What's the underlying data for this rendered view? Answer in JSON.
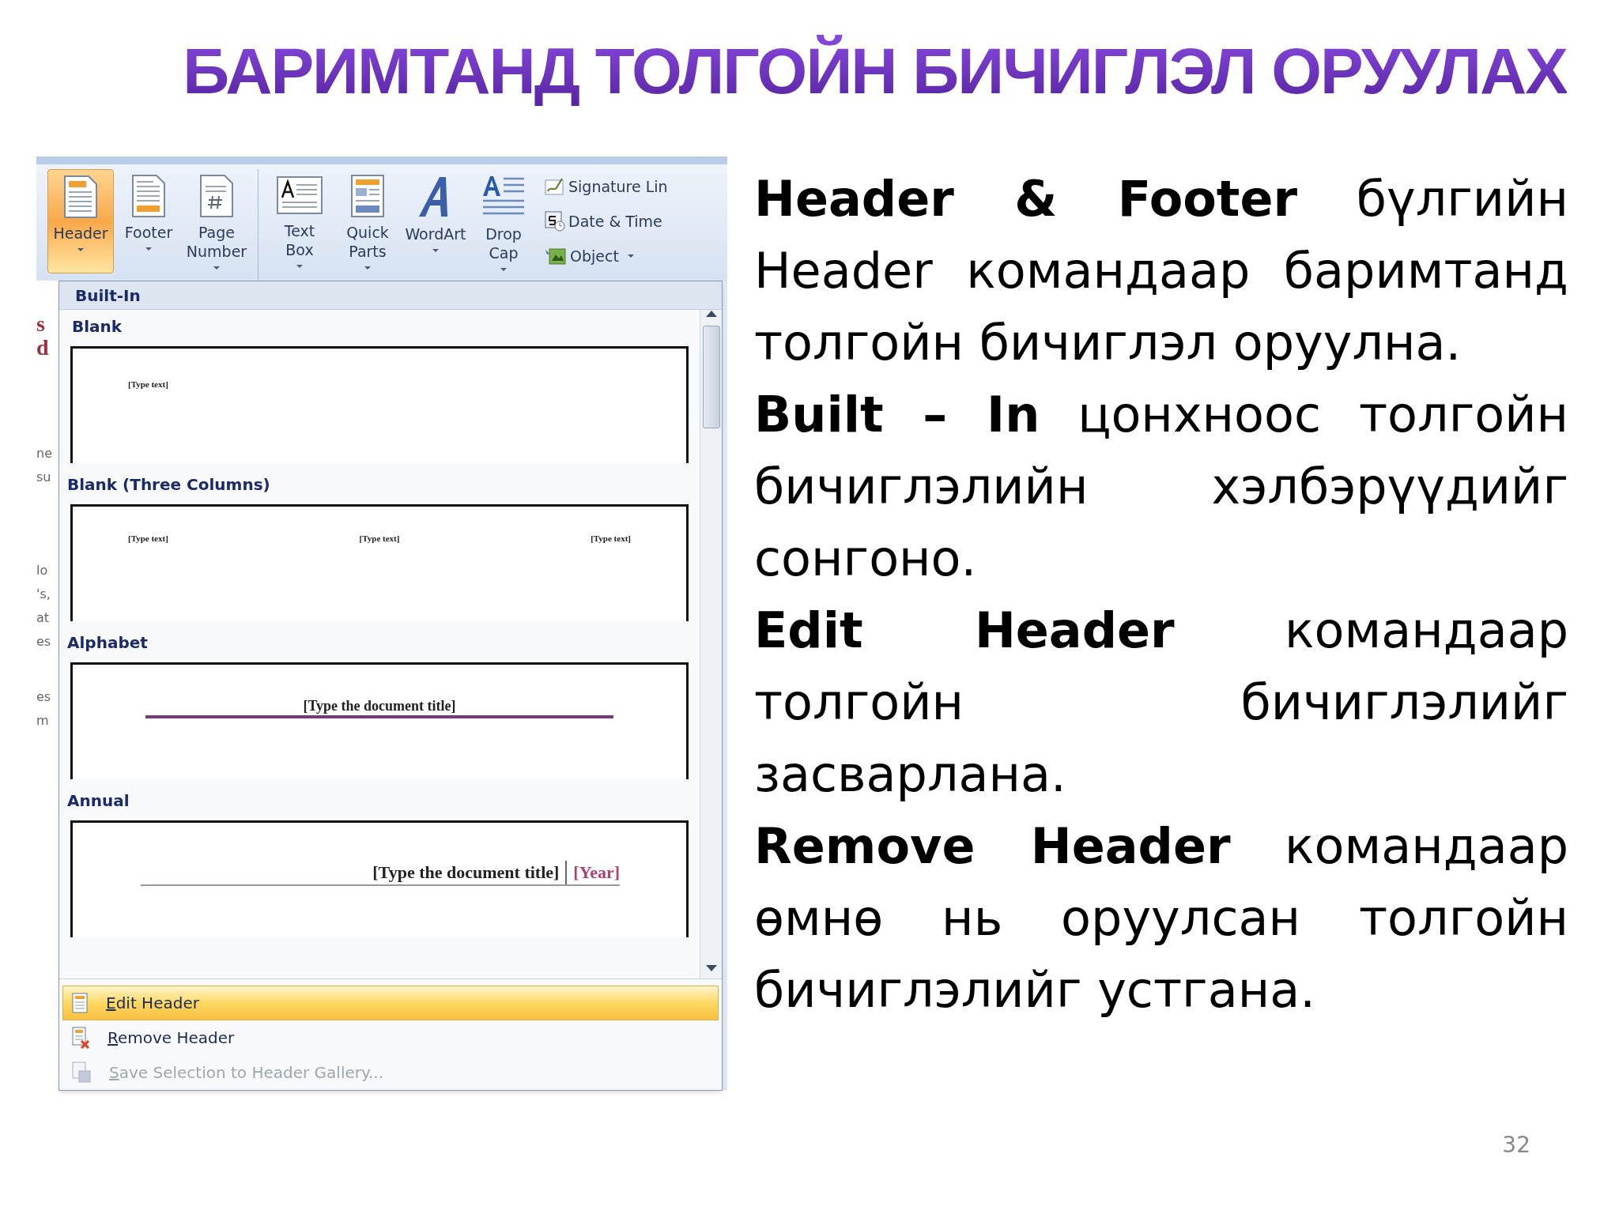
{
  "title": "БАРИМТАНД ТОЛГОЙН БИЧИГЛЭЛ ОРУУЛАХ",
  "ribbon": {
    "groups": [
      {
        "buttons": [
          {
            "lines": [
              "Header"
            ],
            "selected": true,
            "kind": "header"
          },
          {
            "lines": [
              "Footer"
            ],
            "selected": false,
            "kind": "footer"
          },
          {
            "lines": [
              "Page",
              "Number"
            ],
            "selected": false,
            "kind": "page_number"
          }
        ]
      },
      {
        "buttons": [
          {
            "lines": [
              "Text",
              "Box"
            ],
            "selected": false,
            "kind": "text_box"
          },
          {
            "lines": [
              "Quick",
              "Parts"
            ],
            "selected": false,
            "kind": "quick_parts"
          },
          {
            "lines": [
              "WordArt"
            ],
            "selected": false,
            "kind": "wordart"
          },
          {
            "lines": [
              "Drop",
              "Cap"
            ],
            "selected": false,
            "kind": "drop_cap"
          }
        ],
        "small_buttons": [
          {
            "label": "Signature Lin",
            "kind": "signature"
          },
          {
            "label": "Date & Time",
            "kind": "date"
          },
          {
            "label": "Object",
            "kind": "object"
          }
        ]
      }
    ]
  },
  "document_fragments": [
    "s",
    "d",
    "ne",
    "su",
    "lo",
    "'s,",
    "at",
    "es",
    "es",
    "m"
  ],
  "dropdown": {
    "section": "Built-In",
    "gallery": [
      {
        "name": "Blank",
        "kind": "blank",
        "texts": [
          "[Type text]"
        ]
      },
      {
        "name": "Blank (Three Columns)",
        "kind": "three_columns",
        "texts": [
          "[Type text]",
          "[Type text]",
          "[Type text]"
        ]
      },
      {
        "name": "Alphabet",
        "kind": "alphabet",
        "texts": [
          "[Type the document title]"
        ]
      },
      {
        "name": "Annual",
        "kind": "annual",
        "texts": [
          "[Type the document title]",
          "[Year]"
        ]
      }
    ],
    "menu": [
      {
        "label": "Edit Header",
        "selected": true,
        "disabled": false,
        "kind": "edit"
      },
      {
        "label": "Remove Header",
        "selected": false,
        "disabled": false,
        "kind": "remove"
      },
      {
        "label": "Save Selection to Header Gallery...",
        "selected": false,
        "disabled": true,
        "kind": "save"
      }
    ]
  },
  "paragraphs": [
    "**Header & Footer** бүлгийн Header командаар баримтанд толгойн бичиглэл оруулна.",
    "**Built – In** цонхноос толгойн бичиглэлийн хэлбэрүүдийг сонгоно.",
    "**Edit Header** командаар толгойн бичиглэлийг засварлана.",
    "**Remove Header** командаар өмнө нь оруулсан толгойн бичиглэлийг устгана."
  ],
  "page_number": "32"
}
